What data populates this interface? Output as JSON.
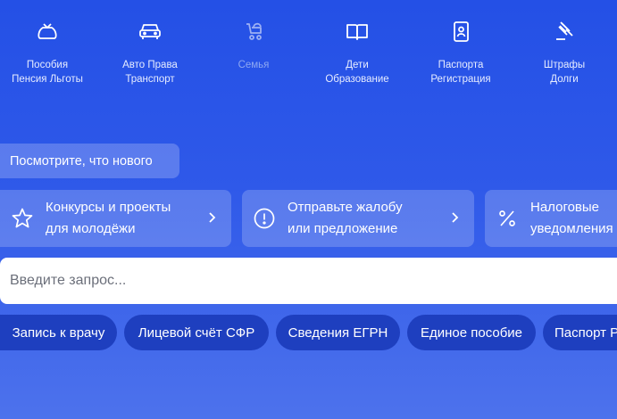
{
  "categories": [
    {
      "line1": "Пособия",
      "line2": "Пенсия Льготы",
      "icon": "money-bag-icon"
    },
    {
      "line1": "Авто Права",
      "line2": "Транспорт",
      "icon": "car-icon"
    },
    {
      "line1": "Семья",
      "line2": "",
      "icon": "stroller-icon"
    },
    {
      "line1": "Дети",
      "line2": "Образование",
      "icon": "book-icon"
    },
    {
      "line1": "Паспорта",
      "line2": "Регистрация",
      "icon": "passport-icon"
    },
    {
      "line1": "Штрафы",
      "line2": "Долги",
      "icon": "gavel-icon"
    }
  ],
  "news_label": "Посмотрите, что нового",
  "cards": [
    {
      "line1": "Конкурсы и проекты",
      "line2": "для молодёжи",
      "icon": "star-icon"
    },
    {
      "line1": "Отправьте жалобу",
      "line2": "или предложение",
      "icon": "exclamation-circle-icon"
    },
    {
      "line1": "Налоговые",
      "line2": "уведомления",
      "icon": "percent-icon"
    }
  ],
  "search": {
    "placeholder": "Введите запрос..."
  },
  "quick_links": [
    "Запись к врачу",
    "Лицевой счёт СФР",
    "Сведения ЕГРН",
    "Единое пособие",
    "Паспорт РФ"
  ],
  "colors": {
    "background": "#2450e6",
    "pill": "#1e3fbf",
    "muted_label": "#8ea8f2"
  }
}
